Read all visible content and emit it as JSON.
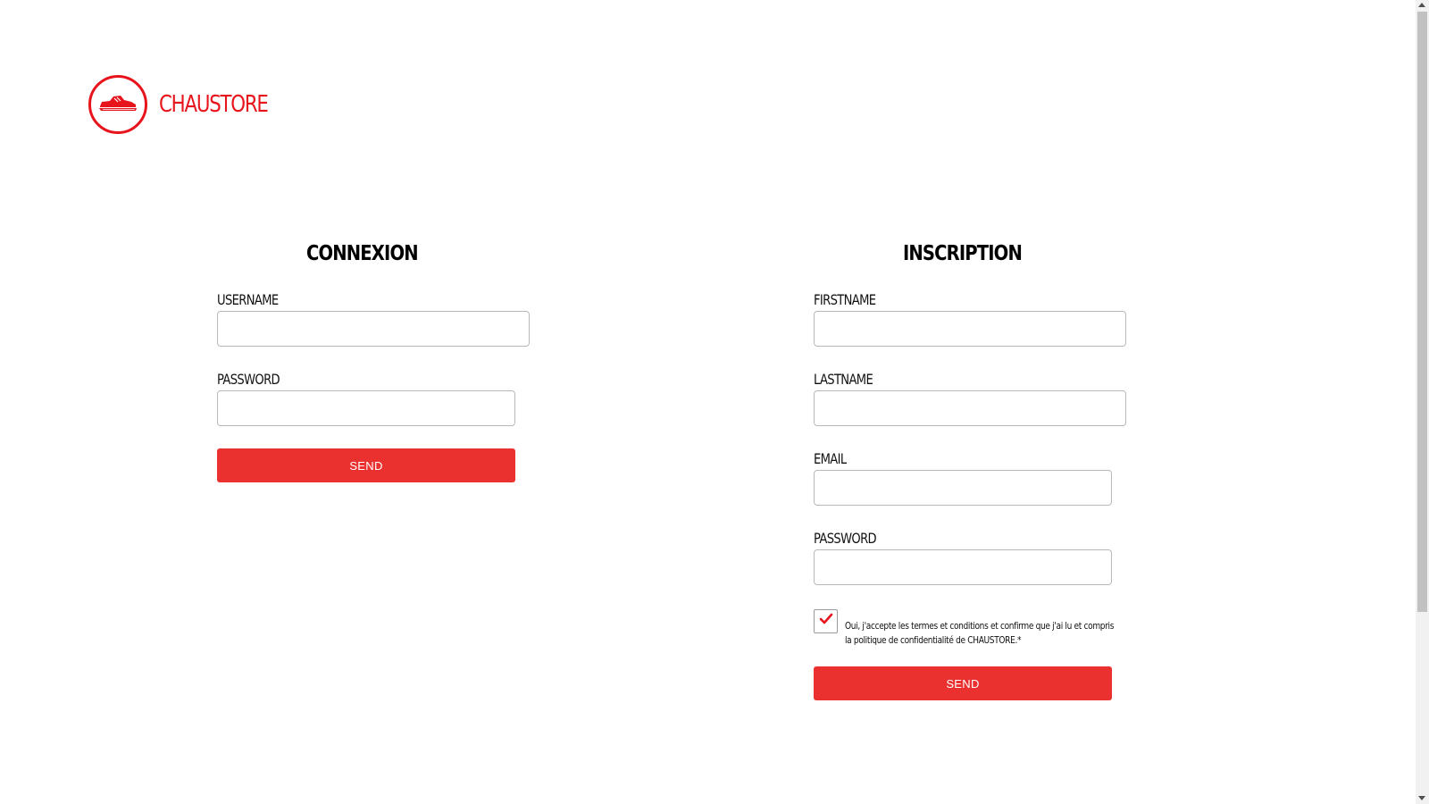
{
  "brand": {
    "name": "CHAUSTORE",
    "logo_icon": "sneaker-icon",
    "color": "#e8141c"
  },
  "login": {
    "title": "CONNEXION",
    "username_label": "USERNAME",
    "username_value": "",
    "password_label": "PASSWORD",
    "password_value": "",
    "send_label": "SEND"
  },
  "register": {
    "title": "INSCRIPTION",
    "firstname_label": "FIRSTNAME",
    "firstname_value": "",
    "lastname_label": "LASTNAME",
    "lastname_value": "",
    "email_label": "EMAIL",
    "email_value": "",
    "password_label": "PASSWORD",
    "password_value": "",
    "terms_checked": true,
    "terms_icon": "checkmark-icon",
    "terms_text": "Oui, j'accepte les termes et conditions et confirme que j'ai lu et compris la politique de confidentialité de CHAUSTORE.*",
    "send_label": "SEND"
  },
  "colors": {
    "button": "#ea3130",
    "text": "#000000",
    "input_border": "#b9b9b9"
  }
}
